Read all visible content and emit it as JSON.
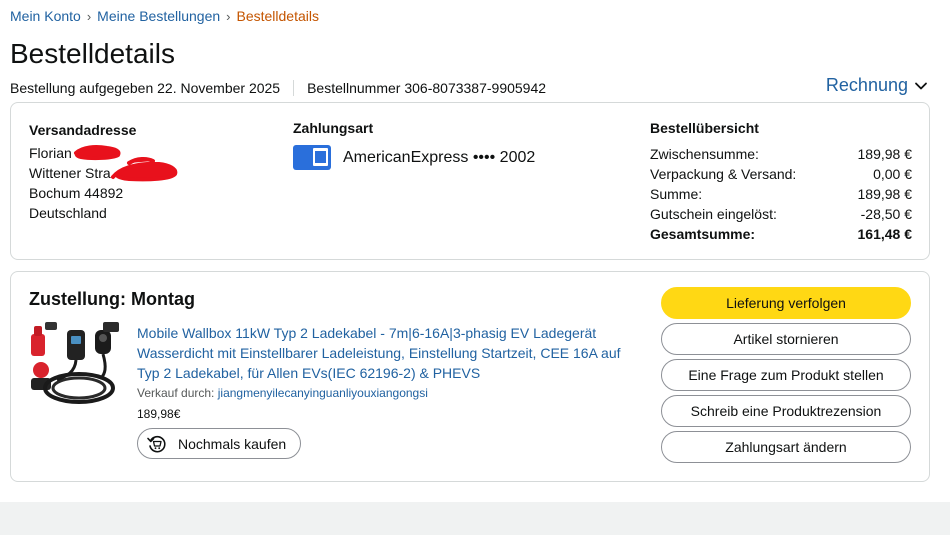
{
  "breadcrumb": {
    "items": [
      "Mein Konto",
      "Meine Bestellungen"
    ],
    "separator": "›",
    "current": "Bestelldetails"
  },
  "page": {
    "title": "Bestelldetails",
    "order_date_label": "Bestellung aufgegeben 22. November 2025",
    "order_number_label": "Bestellnummer 306-8073387-9905942",
    "invoice_label": "Rechnung"
  },
  "shipping": {
    "heading": "Versandadresse",
    "line1": "Florian",
    "line2": "Wittener Stra",
    "line3": "Bochum 44892",
    "line4": "Deutschland"
  },
  "payment": {
    "heading": "Zahlungsart",
    "card_text": "AmericanExpress •••• 2002",
    "card_color": "#2a6fdb"
  },
  "summary": {
    "heading": "Bestellübersicht",
    "rows": [
      {
        "label": "Zwischensumme:",
        "value": "189,98 €"
      },
      {
        "label": "Verpackung & Versand:",
        "value": "0,00 €"
      },
      {
        "label": "Summe:",
        "value": "189,98 €"
      },
      {
        "label": "Gutschein eingelöst:",
        "value": "-28,50 €"
      }
    ],
    "total": {
      "label": "Gesamtsumme:",
      "value": "161,48 €"
    }
  },
  "delivery": {
    "title": "Zustellung: Montag"
  },
  "product": {
    "title": "Mobile Wallbox 11kW Typ 2 Ladekabel - 7m|6-16A|3-phasig EV Ladegerät Wasserdicht mit Einstellbarer Ladeleistung, Einstellung Startzeit, CEE 16A auf Typ 2 Ladekabel, für Allen EVs(IEC 62196-2) & PHEVS",
    "seller_label": "Verkauf durch:",
    "seller_name": "jiangmenyilecanyinguanliyouxiangongsi",
    "price": "189,98€",
    "rebuy_label": "Nochmals kaufen"
  },
  "actions": {
    "track": "Lieferung verfolgen",
    "cancel": "Artikel stornieren",
    "question": "Eine Frage zum Produkt stellen",
    "review": "Schreib eine Produktrezension",
    "change_payment": "Zahlungsart ändern"
  },
  "colors": {
    "link": "#2162a1",
    "breadcrumb_current": "#c45500",
    "primary_button": "#ffd814",
    "redaction": "#e8111c"
  },
  "icons": [
    "chevron-down-icon",
    "amex-card-icon",
    "rebuy-icon",
    "product-image"
  ]
}
